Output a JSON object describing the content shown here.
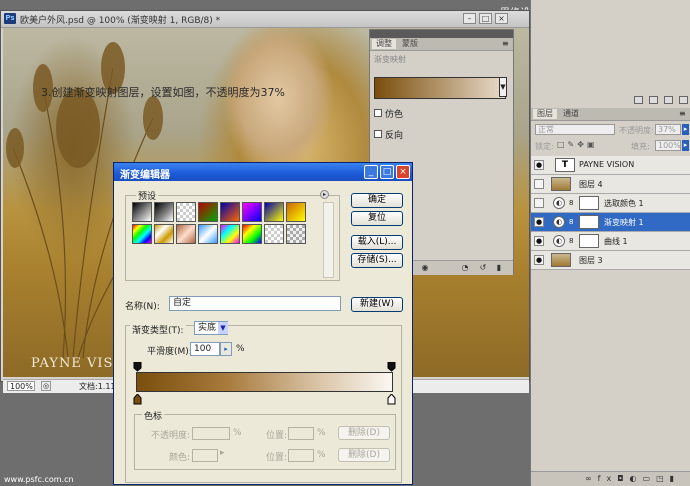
{
  "watermark_top": "思缘设计论坛 WWW.MISSYUAN.COM",
  "watermark_bottom": "www.psfc.com.cn",
  "document": {
    "title": "欧美户外风.psd @ 100% (渐变映射 1, RGB/8) *",
    "annotation": "3.创建渐变映射图层，设置如图，不透明度为37%",
    "photo_text": "PAYNE VISION",
    "zoom": "100%",
    "doc_info": "文档:1.11M"
  },
  "adjust_panel": {
    "tabs": [
      "调整",
      "蒙版"
    ],
    "heading": "渐变映射",
    "dither_label": "仿色",
    "reverse_label": "反向"
  },
  "layers_panel": {
    "tabs": [
      "图层",
      "通道"
    ],
    "blend_mode": "正常",
    "opacity_label": "不透明度:",
    "opacity_value": "37%",
    "lock_label": "锁定:",
    "fill_label": "填充:",
    "fill_value": "100%",
    "layers": [
      {
        "name": "PAYNE VISION",
        "kind": "text",
        "selected": false,
        "visible": true
      },
      {
        "name": "图层 4",
        "kind": "photo",
        "selected": false,
        "visible": false
      },
      {
        "name": "选取颜色 1",
        "kind": "adjustment",
        "selected": false,
        "visible": false
      },
      {
        "name": "渐变映射 1",
        "kind": "adjustment",
        "selected": true,
        "visible": true
      },
      {
        "name": "曲线 1",
        "kind": "adjustment",
        "selected": false,
        "visible": true
      },
      {
        "name": "图层 3",
        "kind": "photo",
        "selected": false,
        "visible": true
      }
    ]
  },
  "gradient_editor": {
    "title": "渐变编辑器",
    "presets_label": "预设",
    "buttons": {
      "ok": "确定",
      "reset": "复位",
      "load": "载入(L)...",
      "save": "存储(S)...",
      "new": "新建(W)"
    },
    "name_label": "名称(N):",
    "name_value": "自定",
    "gradient_type_label": "渐变类型(T):",
    "gradient_type_value": "实底",
    "smoothness_label": "平滑度(M):",
    "smoothness_value": "100",
    "smoothness_unit": "%",
    "color_stops_label": "色标",
    "opacity_label": "不透明度:",
    "location_label": "位置:",
    "color_label": "颜色:",
    "percent": "%",
    "delete_label": "删除(D)",
    "gradient_start_color": "#7a4e0c",
    "gradient_end_color": "#fbf7f2"
  }
}
